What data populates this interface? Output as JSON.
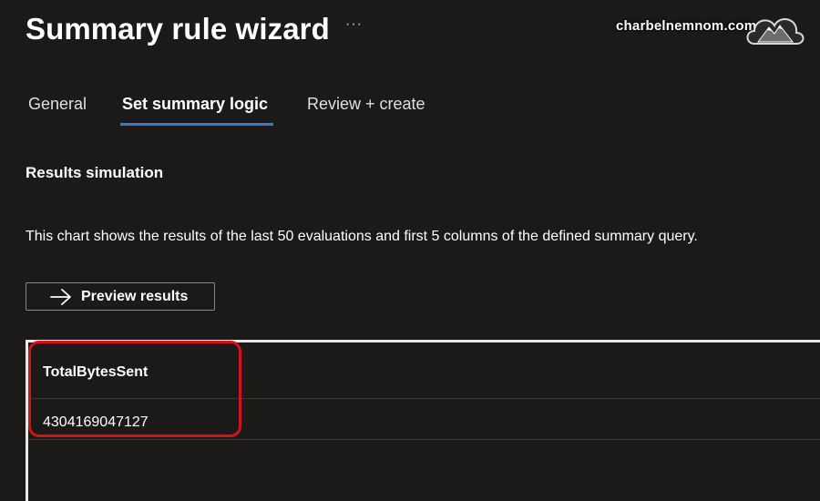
{
  "header": {
    "title": "Summary rule wizard",
    "more_label": "···"
  },
  "watermark": {
    "text": "charbelnemnom.com",
    "icon": "cloud-mountain-logo-icon"
  },
  "tabs": [
    {
      "label": "General",
      "active": false
    },
    {
      "label": "Set summary logic",
      "active": true
    },
    {
      "label": "Review + create",
      "active": false
    }
  ],
  "section": {
    "title": "Results simulation",
    "description": "This chart shows the results of the last 50 evaluations and first 5 columns of the defined summary query."
  },
  "preview_button": {
    "label": "Preview results",
    "icon": "arrow-right-icon"
  },
  "results_table": {
    "columns": [
      "TotalBytesSent"
    ],
    "rows": [
      [
        "4304169047127"
      ]
    ]
  },
  "colors": {
    "background": "#1b1a19",
    "accent": "#2f7bd6",
    "highlight": "#d0141c"
  }
}
